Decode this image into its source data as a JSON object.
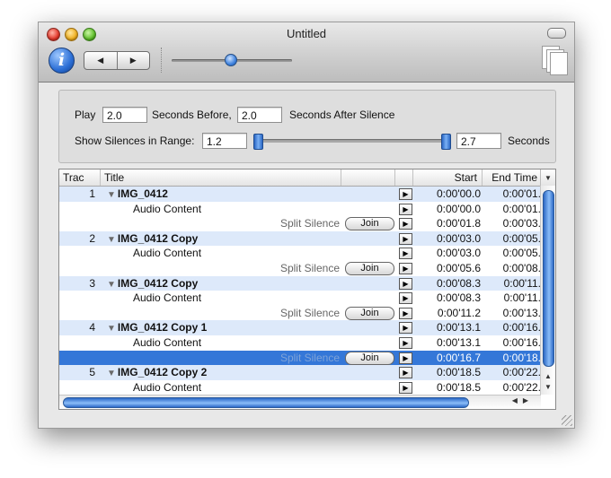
{
  "window": {
    "title": "Untitled"
  },
  "controls": {
    "play_label": "Play",
    "before_value": "2.0",
    "before_label": "Seconds Before,",
    "after_value": "2.0",
    "after_label": "Seconds After Silence",
    "range_label": "Show Silences in Range:",
    "range_min": "1.2",
    "range_max": "2.7",
    "range_unit": "Seconds"
  },
  "table": {
    "columns": {
      "track": "Trac",
      "title": "Title",
      "start": "Start",
      "end": "End Time"
    },
    "rows": [
      {
        "kind": "track",
        "num": "1",
        "title": "IMG_0412",
        "start": "0:00'00.0",
        "end": "0:00'01."
      },
      {
        "kind": "content",
        "title": "Audio Content",
        "start": "0:00'00.0",
        "end": "0:00'01."
      },
      {
        "kind": "split",
        "split": "Split Silence",
        "join": "Join",
        "start": "0:00'01.8",
        "end": "0:00'03."
      },
      {
        "kind": "track",
        "num": "2",
        "title": "IMG_0412 Copy",
        "start": "0:00'03.0",
        "end": "0:00'05."
      },
      {
        "kind": "content",
        "title": "Audio Content",
        "start": "0:00'03.0",
        "end": "0:00'05."
      },
      {
        "kind": "split",
        "split": "Split Silence",
        "join": "Join",
        "start": "0:00'05.6",
        "end": "0:00'08."
      },
      {
        "kind": "track",
        "num": "3",
        "title": "IMG_0412 Copy",
        "start": "0:00'08.3",
        "end": "0:00'11."
      },
      {
        "kind": "content",
        "title": "Audio Content",
        "start": "0:00'08.3",
        "end": "0:00'11."
      },
      {
        "kind": "split",
        "split": "Split Silence",
        "join": "Join",
        "start": "0:00'11.2",
        "end": "0:00'13."
      },
      {
        "kind": "track",
        "num": "4",
        "title": "IMG_0412 Copy 1",
        "start": "0:00'13.1",
        "end": "0:00'16."
      },
      {
        "kind": "content",
        "title": "Audio Content",
        "start": "0:00'13.1",
        "end": "0:00'16."
      },
      {
        "kind": "split",
        "selected": true,
        "split": "Split Silence",
        "join": "Join",
        "start": "0:00'16.7",
        "end": "0:00'18."
      },
      {
        "kind": "track",
        "num": "5",
        "title": "IMG_0412 Copy 2",
        "start": "0:00'18.5",
        "end": "0:00'22."
      },
      {
        "kind": "content",
        "title": "Audio Content",
        "start": "0:00'18.5",
        "end": "0:00'22."
      }
    ]
  },
  "icons": {
    "info": "info-icon",
    "back": "back-arrow-icon",
    "forward": "forward-arrow-icon",
    "document": "document-icon",
    "play": "play-icon",
    "disclosure": "disclosure-triangle-icon"
  },
  "glyphs": {
    "info": "i",
    "back": "◀",
    "forward": "▶",
    "play": "▶",
    "disclosure": "▼",
    "column_menu": "▼",
    "scroll_up": "▲",
    "scroll_down": "▼",
    "scroll_left": "◀",
    "scroll_right": "▶"
  },
  "colors": {
    "selection": "#3477d8",
    "row_alt": "#dde9fa",
    "accent": "#2c69c6"
  }
}
